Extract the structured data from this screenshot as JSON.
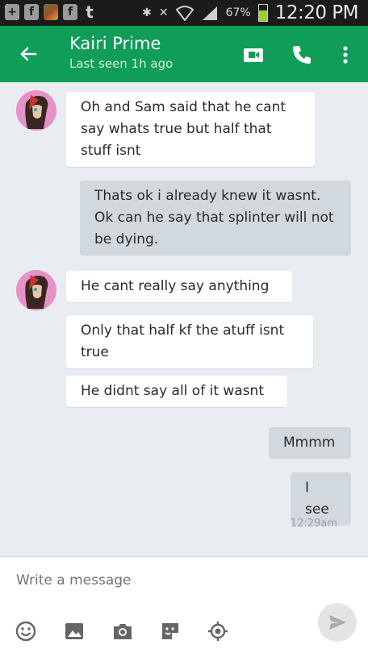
{
  "status_bar": {
    "left_icons": [
      "plus-box-icon",
      "facebook-icon",
      "photo-icon",
      "facebook-icon",
      "twitter-icon"
    ],
    "battery_percent": "67%",
    "battery_level": 0.67,
    "time": "12:20 PM"
  },
  "header": {
    "title": "Kairi Prime",
    "subtitle": "Last seen 1h ago",
    "actions": [
      "video-call-icon",
      "phone-call-icon",
      "more-vert-icon"
    ]
  },
  "messages": [
    {
      "side": "in",
      "text": "Oh and Sam said that he cant say whats true but half that stuff isnt"
    },
    {
      "side": "out",
      "text": "Thats ok i already knew it wasnt. Ok can he say that splinter will not be dying."
    },
    {
      "side": "in",
      "text": "He cant really say anything"
    },
    {
      "side": "in",
      "text": "Only that half kf the atuff isnt true"
    },
    {
      "side": "in",
      "text": "He didnt say all of it wasnt"
    },
    {
      "side": "out",
      "text": "Mmmm"
    },
    {
      "side": "out",
      "text": "I see"
    }
  ],
  "last_timestamp": "12:29am",
  "composer": {
    "placeholder": "Write a message",
    "tools": [
      "emoji-icon",
      "gallery-icon",
      "camera-icon",
      "sticker-icon",
      "location-icon"
    ],
    "send": "send-icon"
  },
  "colors": {
    "app_bar": "#0f9d58",
    "status_bar": "#1b1b1b",
    "background": "#e9edf1",
    "incoming_bubble": "#ffffff",
    "outgoing_bubble": "#d2d9de"
  }
}
